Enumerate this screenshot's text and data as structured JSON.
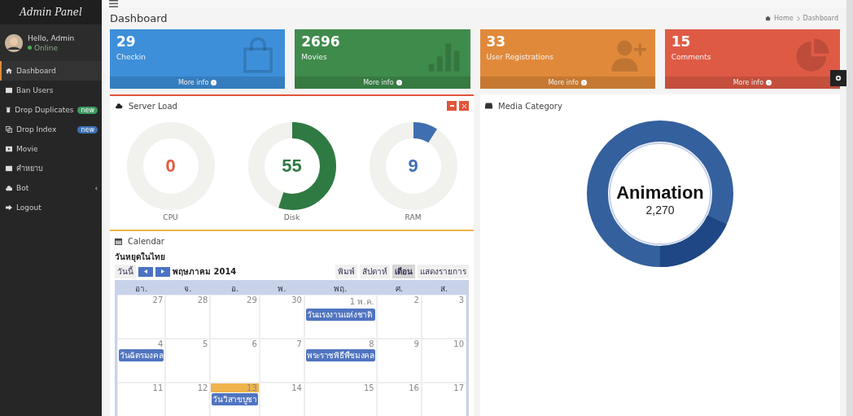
{
  "sidebar": {
    "brand": "Admin Panel",
    "user": {
      "greeting": "Hello, Admin",
      "status": "Online"
    },
    "items": [
      {
        "label": "Dashboard",
        "selected": true
      },
      {
        "label": "Ban Users",
        "selected": false
      },
      {
        "label": "Drop Duplicates",
        "selected": false,
        "badge": "new",
        "color": "#3c9a5f"
      },
      {
        "label": "Drop Index",
        "selected": false,
        "badge": "new",
        "color": "#3c6fb4"
      },
      {
        "label": "Movie",
        "selected": false
      },
      {
        "label": "คำหยาบ",
        "selected": false
      },
      {
        "label": "Bot",
        "selected": false,
        "caret": "‹"
      },
      {
        "label": "Logout",
        "selected": false
      }
    ]
  },
  "page": {
    "title": "Dashboard",
    "breadcrumb": [
      "Home",
      "Dashboard"
    ]
  },
  "stats": [
    {
      "value": "29",
      "label": "Checkin",
      "link": "More info",
      "color": "#3d8fd9"
    },
    {
      "value": "2696",
      "label": "Movies",
      "link": "More info",
      "color": "#3f8b4c"
    },
    {
      "value": "33",
      "label": "User Registrations",
      "link": "More info",
      "color": "#e1893a"
    },
    {
      "value": "15",
      "label": "Comments",
      "link": "More info",
      "color": "#df5a45"
    }
  ],
  "server_load": {
    "title": "Server Load",
    "gauges": [
      {
        "value": "0",
        "label": "CPU",
        "level": 0,
        "color": "#e35b3f"
      },
      {
        "value": "55",
        "label": "Disk",
        "level": 0.55,
        "color": "#2f7a43"
      },
      {
        "value": "9",
        "label": "RAM",
        "level": 0.09,
        "color": "#3f6fb0"
      }
    ]
  },
  "media": {
    "title": "Media Category",
    "center_label": "Animation",
    "center_value": "2,270"
  },
  "calendar": {
    "title": "Calendar",
    "name": "วันหยุดในไทย",
    "today_button": "วันนี้",
    "month": "พฤษภาคม 2014",
    "print": "พิมพ์",
    "views": [
      {
        "label": "สัปดาห์",
        "selected": false
      },
      {
        "label": "เดือน",
        "selected": true
      },
      {
        "label": "แสดงรายการ",
        "selected": false
      }
    ],
    "weekdays": [
      "อา.",
      "จ.",
      "อ.",
      "พ.",
      "พฤ.",
      "ศ.",
      "ส."
    ],
    "weeks": [
      [
        {
          "day": "27",
          "today": false
        },
        {
          "day": "28",
          "today": false
        },
        {
          "day": "29",
          "today": false
        },
        {
          "day": "30",
          "today": false
        },
        {
          "day": "1 พ.ค.",
          "today": false,
          "event": "วันแรงงานแห่งชาติ"
        },
        {
          "day": "2",
          "today": false
        },
        {
          "day": "3",
          "today": false
        }
      ],
      [
        {
          "day": "4",
          "today": false,
          "event": "วันฉัตรมงคล"
        },
        {
          "day": "5",
          "today": false
        },
        {
          "day": "6",
          "today": false
        },
        {
          "day": "7",
          "today": false
        },
        {
          "day": "8",
          "today": false,
          "event": "พระราชพิธีพืชมงคล"
        },
        {
          "day": "9",
          "today": false
        },
        {
          "day": "10",
          "today": false
        }
      ],
      [
        {
          "day": "11",
          "today": false
        },
        {
          "day": "12",
          "today": false
        },
        {
          "day": "13",
          "today": true,
          "event": "วันวิสาขบูชา"
        },
        {
          "day": "14",
          "today": false
        },
        {
          "day": "15",
          "today": false
        },
        {
          "day": "16",
          "today": false
        },
        {
          "day": "17",
          "today": false
        }
      ]
    ]
  }
}
